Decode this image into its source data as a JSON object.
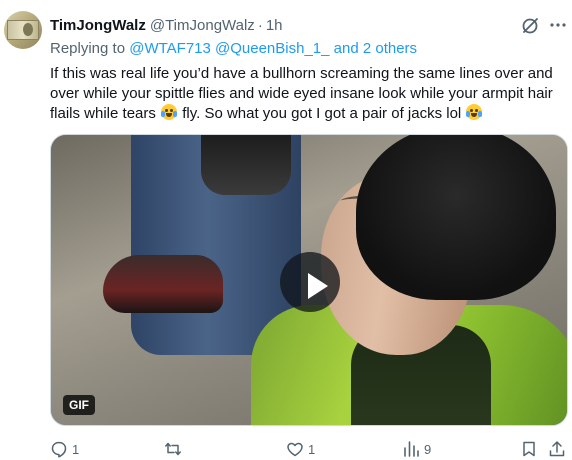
{
  "tweet": {
    "author_name": "TimJongWalz",
    "author_handle": "@TimJongWalz",
    "separator": "·",
    "time": "1h",
    "reply_prefix": "Replying to",
    "reply_mentions": "@WTAF713 @QueenBish_1_ and 2 others",
    "text_part1": "If this was real life you’d have a bullhorn screaming the same lines over and over while your spittle flies and wide eyed insane look while your armpit hair flails while tears",
    "text_part2": "fly. So what you got I got a pair of jacks lol",
    "emoji_1": "loudly-crying-face",
    "emoji_2": "face-with-tears-of-joy",
    "media": {
      "badge": "GIF",
      "play_icon": "play-icon"
    },
    "actions": {
      "reply_count": "1",
      "retweet_count": "",
      "like_count": "1",
      "views_count": "9"
    }
  },
  "colors": {
    "link": "#1d9bf0",
    "secondary_text": "#536471",
    "primary_text": "#0f1419"
  }
}
